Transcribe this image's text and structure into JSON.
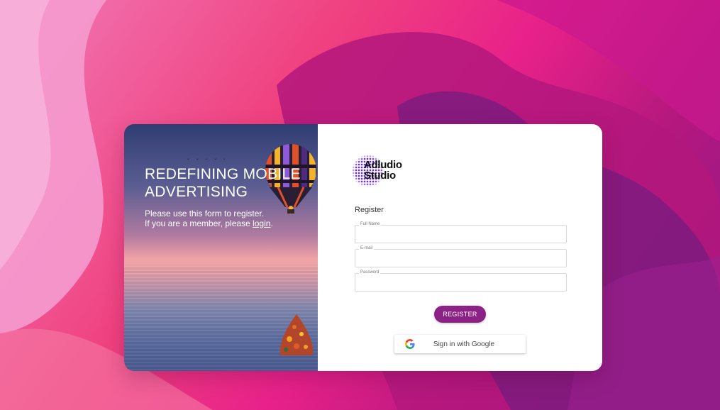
{
  "hero": {
    "headline": "REDEFINING MOBILE ADVERTISING",
    "message_line1": "Please use this form to register.",
    "message_line2_prefix": "If you are a member, please ",
    "login_link": "login",
    "message_line2_suffix": "."
  },
  "brand": {
    "logo_line1": "Adludio",
    "logo_line2": "Studio",
    "accent_color": "#8c2186"
  },
  "form": {
    "title": "Register",
    "fields": [
      {
        "label": "Full Name",
        "value": ""
      },
      {
        "label": "E-mail",
        "value": ""
      },
      {
        "label": "Password",
        "value": ""
      }
    ],
    "register_label": "REGISTER",
    "google_label": "Sign in with Google",
    "google_icon": "google-g-icon"
  }
}
